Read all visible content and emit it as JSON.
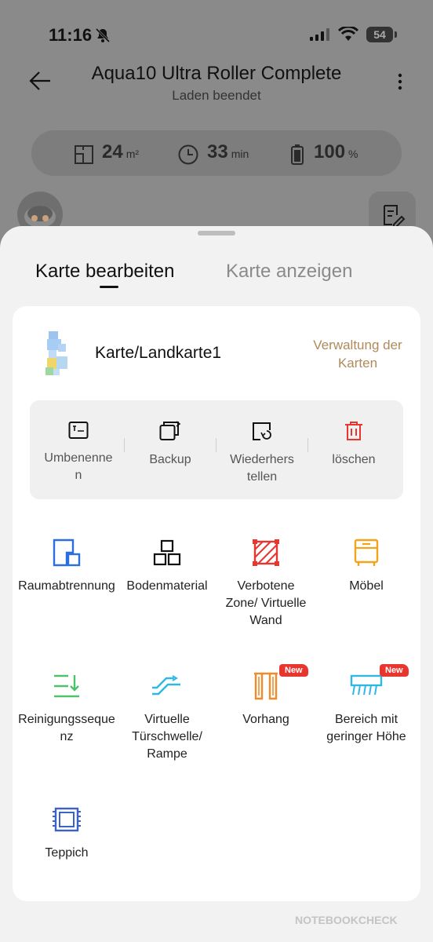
{
  "status_bar": {
    "time": "11:16",
    "battery": "54"
  },
  "header": {
    "title": "Aqua10 Ultra Roller Complete",
    "subtitle": "Laden beendet"
  },
  "stats": [
    {
      "value": "24",
      "unit": "m²"
    },
    {
      "value": "33",
      "unit": "min"
    },
    {
      "value": "100",
      "unit": "%"
    }
  ],
  "tabs": {
    "active": "Karte bearbeiten",
    "inactive": "Karte anzeigen"
  },
  "map": {
    "name": "Karte/Landkarte1",
    "manage_label": "Verwaltung der Karten"
  },
  "actions": [
    {
      "label": "Umbenennen"
    },
    {
      "label": "Backup"
    },
    {
      "label": "Wiederherstellen"
    },
    {
      "label": "löschen"
    }
  ],
  "tools": [
    {
      "label": "Raumabtrennung",
      "icon": "room-divider-icon"
    },
    {
      "label": "Bodenmaterial",
      "icon": "floor-material-icon"
    },
    {
      "label": "Verbotene Zone/ Virtuelle Wand",
      "icon": "no-go-zone-icon"
    },
    {
      "label": "Möbel",
      "icon": "furniture-icon"
    },
    {
      "label": "Reinigungssequenz",
      "icon": "cleaning-sequence-icon"
    },
    {
      "label": "Virtuelle Türschwelle/ Rampe",
      "icon": "threshold-ramp-icon"
    },
    {
      "label": "Vorhang",
      "icon": "curtain-icon",
      "badge": "New"
    },
    {
      "label": "Bereich mit geringer Höhe",
      "icon": "low-height-area-icon",
      "badge": "New"
    },
    {
      "label": "Teppich",
      "icon": "carpet-icon"
    }
  ],
  "colors": {
    "accent_gold": "#b08a5a",
    "blue": "#2a6fe0",
    "red": "#e8362e",
    "orange": "#f28a2a",
    "green": "#4cc26a",
    "cyan": "#2fb8e6"
  },
  "watermark": "NOTEBOOKCHECK"
}
